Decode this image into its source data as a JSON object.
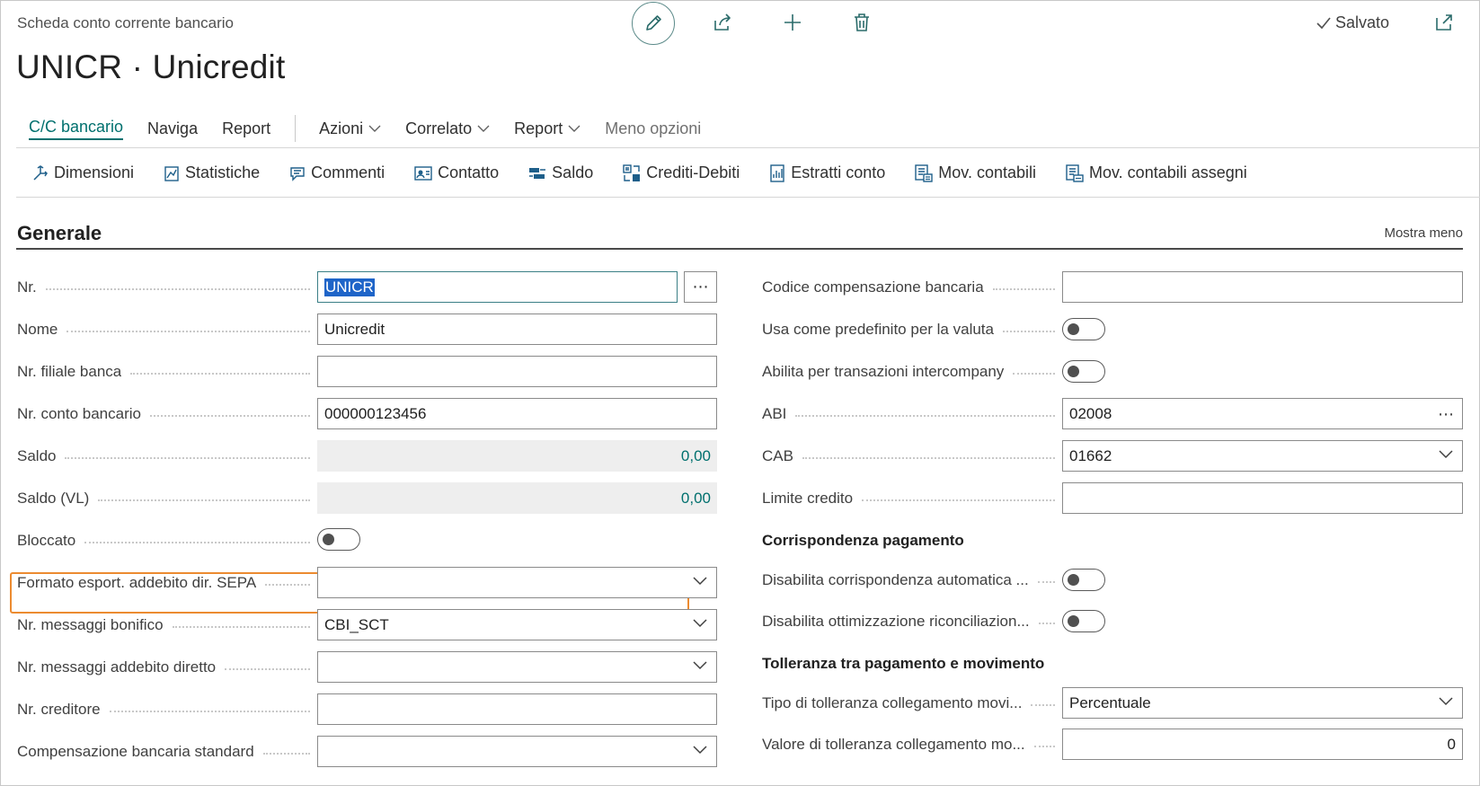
{
  "header": {
    "page_kind": "Scheda conto corrente bancario",
    "title": "UNICR · Unicredit",
    "status": "Salvato"
  },
  "tabs": [
    {
      "label": "C/C bancario",
      "active": true
    },
    {
      "label": "Naviga"
    },
    {
      "label": "Report"
    },
    {
      "label": "Azioni",
      "dropdown": true
    },
    {
      "label": "Correlato",
      "dropdown": true
    },
    {
      "label": "Report",
      "dropdown": true
    },
    {
      "label": "Meno opzioni"
    }
  ],
  "actions": [
    {
      "label": "Dimensioni",
      "icon": "dimensions-icon"
    },
    {
      "label": "Statistiche",
      "icon": "statistics-icon"
    },
    {
      "label": "Commenti",
      "icon": "comments-icon"
    },
    {
      "label": "Contatto",
      "icon": "contact-icon"
    },
    {
      "label": "Saldo",
      "icon": "balance-icon"
    },
    {
      "label": "Crediti-Debiti",
      "icon": "receivables-payables-icon"
    },
    {
      "label": "Estratti conto",
      "icon": "statements-icon"
    },
    {
      "label": "Mov. contabili",
      "icon": "ledger-entries-icon"
    },
    {
      "label": "Mov. contabili assegni",
      "icon": "check-ledger-entries-icon"
    }
  ],
  "section": {
    "title": "Generale",
    "toggle_label": "Mostra meno"
  },
  "left_fields": {
    "nr": {
      "label": "Nr.",
      "value": "UNICR"
    },
    "nome": {
      "label": "Nome",
      "value": "Unicredit"
    },
    "filiale": {
      "label": "Nr. filiale banca",
      "value": ""
    },
    "conto": {
      "label": "Nr. conto bancario",
      "value": "000000123456"
    },
    "saldo": {
      "label": "Saldo",
      "value": "0,00"
    },
    "saldo_vl": {
      "label": "Saldo (VL)",
      "value": "0,00"
    },
    "bloccato": {
      "label": "Bloccato",
      "value": false
    },
    "sepa": {
      "label": "Formato esport. addebito dir. SEPA",
      "value": ""
    },
    "bonifico": {
      "label": "Nr. messaggi bonifico",
      "value": "CBI_SCT"
    },
    "addebito": {
      "label": "Nr. messaggi addebito diretto",
      "value": ""
    },
    "creditore": {
      "label": "Nr. creditore",
      "value": ""
    },
    "compensazione": {
      "label": "Compensazione bancaria standard",
      "value": ""
    }
  },
  "right_fields": {
    "codice": {
      "label": "Codice compensazione bancaria",
      "value": ""
    },
    "predefinito": {
      "label": "Usa come predefinito per la valuta",
      "value": false
    },
    "intercompany": {
      "label": "Abilita per transazioni intercompany",
      "value": false
    },
    "abi": {
      "label": "ABI",
      "value": "02008"
    },
    "cab": {
      "label": "CAB",
      "value": "01662"
    },
    "limite": {
      "label": "Limite credito",
      "value": ""
    },
    "group1": "Corrispondenza pagamento",
    "auto_match": {
      "label": "Disabilita corrispondenza automatica ...",
      "value": false
    },
    "ottimizzazione": {
      "label": "Disabilita ottimizzazione riconciliazion...",
      "value": false
    },
    "group2": "Tolleranza tra pagamento e movimento",
    "tipo_toll": {
      "label": "Tipo di tolleranza collegamento movi...",
      "value": "Percentuale"
    },
    "valore_toll": {
      "label": "Valore di tolleranza collegamento mo...",
      "value": "0"
    }
  },
  "colors": {
    "accent": "#00706e",
    "highlight": "#ec8b30",
    "selection": "#1e64c8"
  }
}
